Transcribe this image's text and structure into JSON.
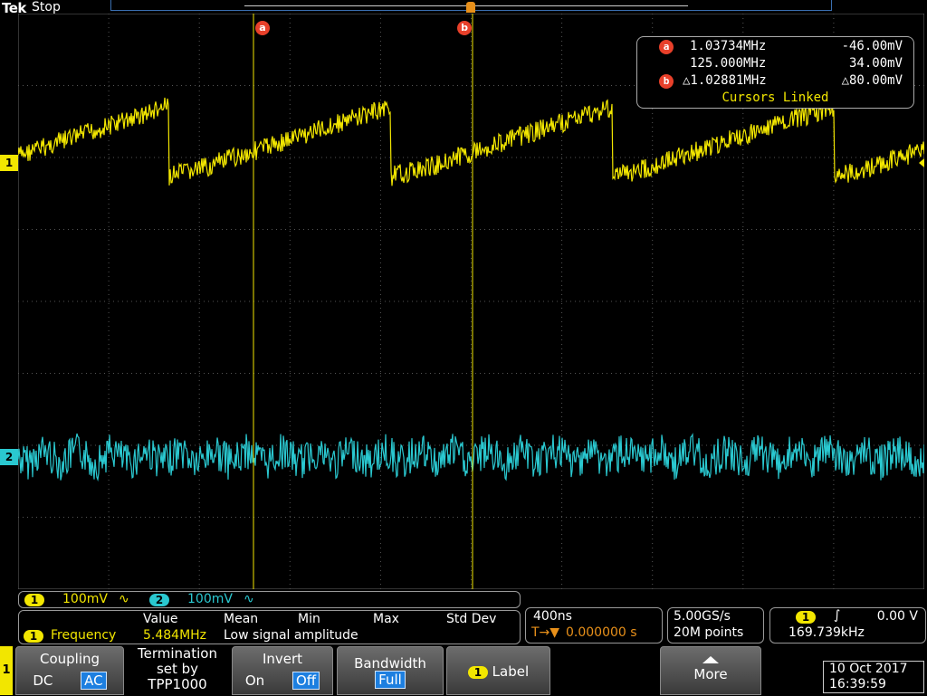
{
  "header": {
    "brand": "Tek",
    "state": "Stop"
  },
  "channels": [
    {
      "id": "1",
      "color": "#f2e600"
    },
    {
      "id": "2",
      "color": "#2ac8d0"
    }
  ],
  "cursors": {
    "a_label": "a",
    "b_label": "b",
    "a_freq": "1.03734MHz",
    "a_volt": "-46.00mV",
    "b_freq": "125.000MHz",
    "b_volt": "34.00mV",
    "delta_freq": "△1.02881MHz",
    "delta_volt": "△80.00mV",
    "linked": "Cursors Linked"
  },
  "vertical": {
    "ch1_scale": "100mV",
    "ch1_coupling_glyph": "∿",
    "ch2_scale": "100mV",
    "ch2_coupling_glyph": "∿"
  },
  "measurement": {
    "headers": [
      "Value",
      "Mean",
      "Min",
      "Max",
      "Std Dev"
    ],
    "channel": "1",
    "name": "Frequency",
    "value": "5.484MHz",
    "note": "Low signal amplitude"
  },
  "horizontal": {
    "scale": "400ns",
    "delay_prefix": "T→▼",
    "delay": "0.000000 s"
  },
  "acquisition": {
    "rate": "5.00GS/s",
    "points": "20M points"
  },
  "trigger": {
    "channel": "1",
    "slope": "∫",
    "level": "0.00 V",
    "freq": "169.739kHz"
  },
  "softkeys": {
    "side_channel": "1",
    "coupling": {
      "title": "Coupling",
      "opt1": "DC",
      "opt2": "AC"
    },
    "termination": {
      "line1": "Termination",
      "line2": "set by",
      "line3": "TPP1000"
    },
    "invert": {
      "title": "Invert",
      "opt1": "On",
      "opt2": "Off"
    },
    "bandwidth": {
      "title": "Bandwidth",
      "value": "Full"
    },
    "label": {
      "channel": "1",
      "title": "Label"
    },
    "more": {
      "title": "More"
    }
  },
  "datetime": {
    "date": "10 Oct  2017",
    "time": "16:39:59"
  }
}
